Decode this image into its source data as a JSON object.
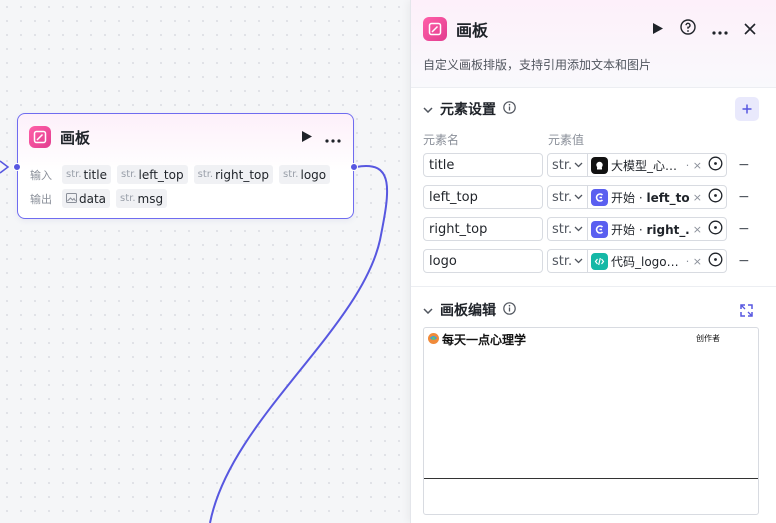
{
  "node": {
    "title": "画板",
    "input_label": "输入",
    "output_label": "输出",
    "inputs": [
      {
        "type": "str.",
        "name": "title"
      },
      {
        "type": "str.",
        "name": "left_top"
      },
      {
        "type": "str.",
        "name": "right_top"
      },
      {
        "type": "str.",
        "name": "logo"
      }
    ],
    "outputs": [
      {
        "type": "",
        "name": "data"
      },
      {
        "type": "str.",
        "name": "msg"
      }
    ]
  },
  "panel": {
    "title": "画板",
    "description": "自定义画板排版，支持引用添加文本和图片",
    "elements_section": {
      "title": "元素设置",
      "col_name": "元素名",
      "col_value": "元素值",
      "rows": [
        {
          "name": "title",
          "type": "str.",
          "ref": "大模型_心…",
          "ref_color": "#111111"
        },
        {
          "name": "left_top",
          "type": "str.",
          "ref_prefix": "开始 · ",
          "ref": "left_top",
          "ref_color": "#5a5ff0"
        },
        {
          "name": "right_top",
          "type": "str.",
          "ref_prefix": "开始 · ",
          "ref": "right_…",
          "ref_color": "#5a5ff0"
        },
        {
          "name": "logo",
          "type": "str.",
          "ref": "代码_logo…",
          "ref_color": "#14b8a6"
        }
      ]
    },
    "editor_section": {
      "title": "画板编辑",
      "canvas_text": "每天一点心理学",
      "canvas_small_text": "创作者"
    }
  },
  "colors": {
    "accent": "#5757e0",
    "brand_pink": "#e23d8f"
  }
}
